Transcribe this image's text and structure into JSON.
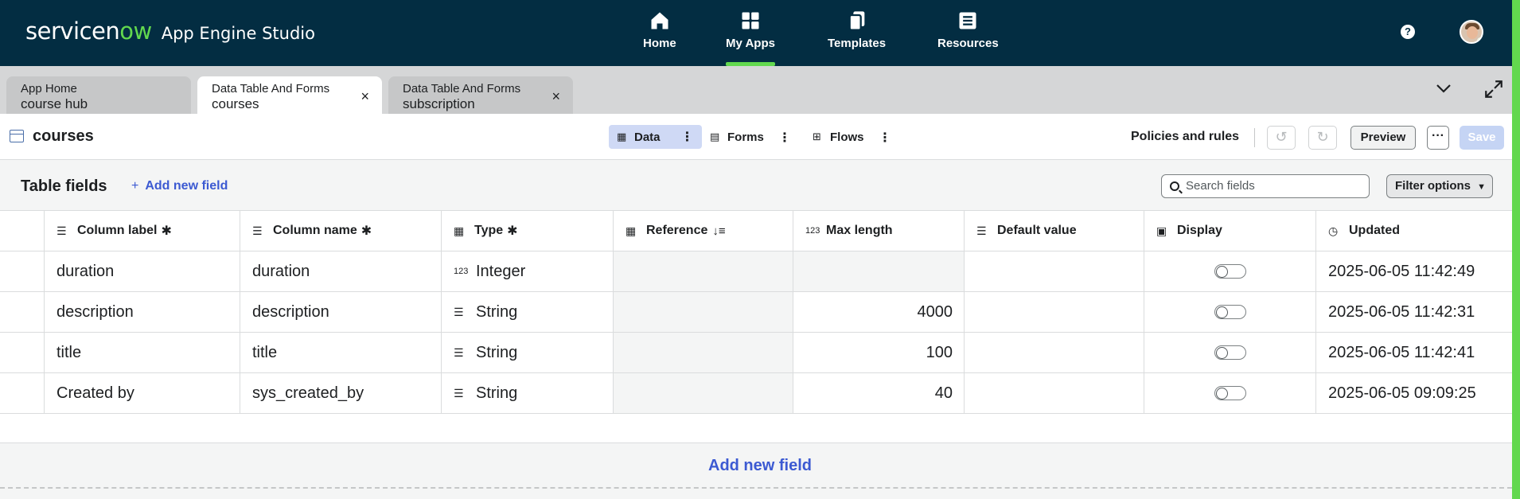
{
  "brand": {
    "logo_left": "servicen",
    "logo_ow": "ow",
    "app_name": "App Engine Studio"
  },
  "nav": [
    {
      "label": "Home",
      "icon": "home-icon"
    },
    {
      "label": "My Apps",
      "icon": "grid-icon"
    },
    {
      "label": "Templates",
      "icon": "pages-icon"
    },
    {
      "label": "Resources",
      "icon": "book-icon"
    }
  ],
  "help_glyph": "?",
  "tabs": [
    {
      "line1": "App Home",
      "line2": "course hub"
    },
    {
      "line1": "Data Table And Forms",
      "line2": "courses"
    },
    {
      "line1": "Data Table And Forms",
      "line2": "subscription"
    }
  ],
  "tab_close": "×",
  "toolbar": {
    "title": "courses",
    "data_label": "Data",
    "forms_label": "Forms",
    "flows_label": "Flows",
    "policies_label": "Policies and rules",
    "preview_label": "Preview",
    "more_label": "···",
    "save_label": "Save"
  },
  "fields": {
    "title": "Table fields",
    "add_label": "Add new field",
    "search_placeholder": "Search fields",
    "filter_label": "Filter options"
  },
  "columns": [
    {
      "label": "Column label",
      "req": "✱"
    },
    {
      "label": "Column name",
      "req": "✱"
    },
    {
      "label": "Type",
      "req": "✱"
    },
    {
      "label": "Reference",
      "req": ""
    },
    {
      "label": "Max length",
      "req": ""
    },
    {
      "label": "Default value",
      "req": ""
    },
    {
      "label": "Display",
      "req": ""
    },
    {
      "label": "Updated",
      "req": ""
    }
  ],
  "rows": [
    {
      "label": "duration",
      "name": "duration",
      "type": "Integer",
      "reference": "",
      "max": "",
      "default": "",
      "display": false,
      "updated": "2025-06-05 11:42:49"
    },
    {
      "label": "description",
      "name": "description",
      "type": "String",
      "reference": "",
      "max": "4000",
      "default": "",
      "display": false,
      "updated": "2025-06-05 11:42:31"
    },
    {
      "label": "title",
      "name": "title",
      "type": "String",
      "reference": "",
      "max": "100",
      "default": "",
      "display": false,
      "updated": "2025-06-05 11:42:41"
    },
    {
      "label": "Created by",
      "name": "sys_created_by",
      "type": "String",
      "reference": "",
      "max": "40",
      "default": "",
      "display": false,
      "updated": "2025-06-05 09:09:25"
    }
  ],
  "bottom_add": "Add new field",
  "colors": {
    "topbar": "#032d42",
    "accent": "#62d84e",
    "link": "#3c5ad2"
  }
}
